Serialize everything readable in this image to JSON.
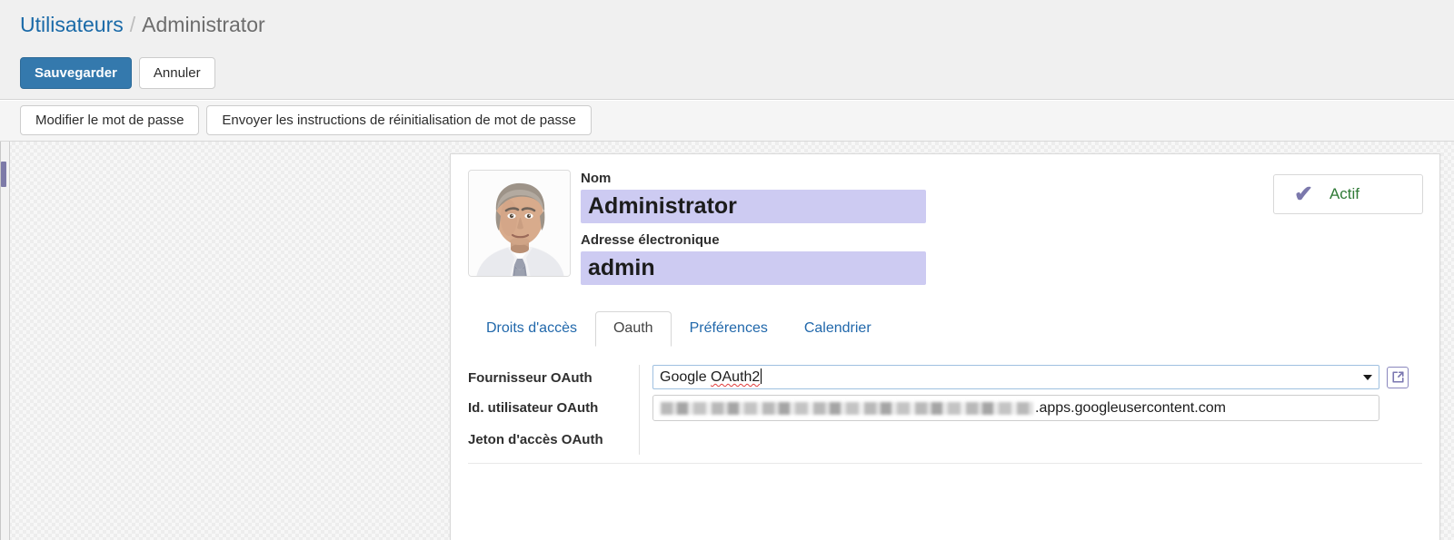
{
  "breadcrumb": {
    "parent": "Utilisateurs",
    "separator": "/",
    "current": "Administrator"
  },
  "toolbar": {
    "save_label": "Sauvegarder",
    "cancel_label": "Annuler"
  },
  "sub_toolbar": {
    "change_password_label": "Modifier le mot de passe",
    "send_reset_label": "Envoyer les instructions de réinitialisation de mot de passe"
  },
  "user": {
    "name_label": "Nom",
    "name_value": "Administrator",
    "email_label": "Adresse électronique",
    "email_value": "admin",
    "avatar_alt": "user-photo"
  },
  "status": {
    "icon": "check-icon",
    "label": "Actif"
  },
  "tabs": [
    {
      "label": "Droits d'accès",
      "active": false
    },
    {
      "label": "Oauth",
      "active": true
    },
    {
      "label": "Préférences",
      "active": false
    },
    {
      "label": "Calendrier",
      "active": false
    }
  ],
  "oauth": {
    "provider_label": "Fournisseur OAuth",
    "provider_value_plain": "Google ",
    "provider_value_misspelled": "OAuth2",
    "provider_external_icon": "external-link-icon",
    "provider_dropdown_icon": "chevron-down-icon",
    "user_id_label": "Id. utilisateur OAuth",
    "user_id_redacted": "",
    "user_id_suffix": ".apps.googleusercontent.com",
    "access_token_label": "Jeton d'accès OAuth",
    "access_token_value": ""
  },
  "colors": {
    "primary_button": "#3479ad",
    "link": "#1a6aa8",
    "input_highlight": "#cdcbf2",
    "status_text": "#2f7a36",
    "check_icon": "#7b78ac",
    "accent_purple": "#8a87bd",
    "spellcheck_underline": "#e03b3b"
  }
}
